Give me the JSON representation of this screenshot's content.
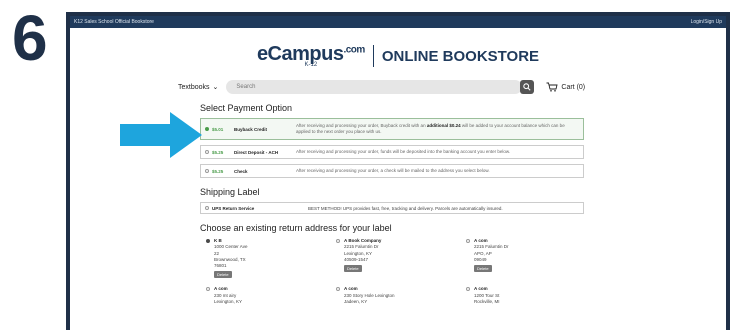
{
  "step_number": "6",
  "topbar": {
    "title": "K12 Sales School Official Bookstore",
    "login": "Login/Sign Up"
  },
  "logo": {
    "brand": "eCampus",
    "tld": ".com",
    "k12": "K-12",
    "store": "ONLINE BOOKSTORE"
  },
  "search": {
    "category": "Textbooks",
    "placeholder": "Search",
    "cart": "Cart (0)"
  },
  "payment": {
    "title": "Select Payment Option",
    "options": [
      {
        "amount": "$5.01",
        "name": "Buyback Credit",
        "desc_pre": "After receiving and processing your order, Buyback credit with an",
        "desc_bold": "additional $0.24",
        "desc_post": "will be added to your account balance which can be applied to the next order you place with us."
      },
      {
        "amount": "$5.25",
        "name": "Direct Deposit - ACH",
        "desc": "After receiving and processing your order, funds will be deposited into the banking account you enter below."
      },
      {
        "amount": "$5.25",
        "name": "Check",
        "desc": "After receiving and processing your order, a check will be mailed to the address you select below."
      }
    ]
  },
  "shipping": {
    "title": "Shipping Label",
    "name": "UPS Return Service",
    "desc": "BEST METHOD! UPS provides fast, free, tracking and delivery. Parcels are automatically insured."
  },
  "addresses": {
    "title": "Choose an existing return address for your label",
    "items": [
      {
        "lines": [
          "K B",
          "1000 Center Ave",
          "22",
          "Brownwood, TX",
          "76801"
        ],
        "delete": "Delete"
      },
      {
        "lines": [
          "A Book Company",
          "2215 Falumtin Dr",
          "Lexington, KY",
          "40509-1547"
        ],
        "delete": "Delete"
      },
      {
        "lines": [
          "A com",
          "2215 Falumtin Dr",
          "APO, AP",
          "09049"
        ],
        "delete": "Delete"
      },
      {
        "lines": [
          "A com",
          "230 mt airy",
          "Lexington, KY"
        ]
      },
      {
        "lines": [
          "A com",
          "230 Story Hole Lexington",
          "Jadeen, KY"
        ]
      },
      {
        "lines": [
          "A com",
          "1200 Tour St",
          "Rockville, MI"
        ]
      }
    ]
  },
  "colors": {
    "navy": "#1f3a5c",
    "arrow": "#1ea5dd",
    "green": "#4a9c4a"
  }
}
